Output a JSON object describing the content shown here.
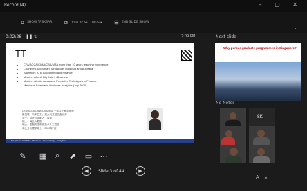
{
  "window": {
    "app_title": "Record (4)",
    "controls": [
      "–",
      "▢",
      "✕"
    ]
  },
  "toolbar": {
    "items": [
      {
        "label": "SHOW TASKBAR",
        "icon": "taskbar-icon"
      },
      {
        "label": "DISPLAY SETTINGS ▾",
        "icon": "display-icon"
      },
      {
        "label": "END SLIDE SHOW",
        "icon": "end-show-icon"
      }
    ],
    "more": "⌄"
  },
  "presenter": {
    "timer": "0:02:28",
    "timer_controls": "❚❚ ↻",
    "clock": "2:09 PM",
    "next_label": "Next slide",
    "notes_label": "No Notes"
  },
  "slide": {
    "title": "TT",
    "bullets": [
      "CFA/ACCA/CIMA/CBA/MBA more than 10 years teaching experience",
      "Chartered Accountant Singapore, Malaysia and Australia",
      "Bachelor : AI in Accounting and Finance",
      "Master : AI and Big Data in Business",
      "Master : AI with Advanced Predictive Techniques in Finance",
      "Master of Science in Business Analytics (July 2020)"
    ],
    "cn_text": "CFA/ACCA/CIMA/CBA/MBA 十年以上教学经验\n新加坡、马来西亚、澳大利亚注册会计师\n学士：会计与金融人工智能\n硕士：商业大数据\n硕士：金融先进预测技术人工智能\n商业分析理学硕士（2020年7月）",
    "footer": "Singapore Institute · Finance · Accounting · Analytics"
  },
  "next_slide": {
    "title": "Why pursue graduate programmes in Singapore?"
  },
  "slide_tools": [
    "pen-tool-icon",
    "grid-view-icon",
    "zoom-icon",
    "pointer-icon",
    "subtitles-icon",
    "more-options-icon"
  ],
  "navigation": {
    "prev": "◀",
    "next": "▶",
    "counter": "Slide 3 of 44"
  },
  "video": {
    "sk_label": "SK"
  },
  "font_controls": {
    "increase": "A",
    "decrease": "A"
  }
}
